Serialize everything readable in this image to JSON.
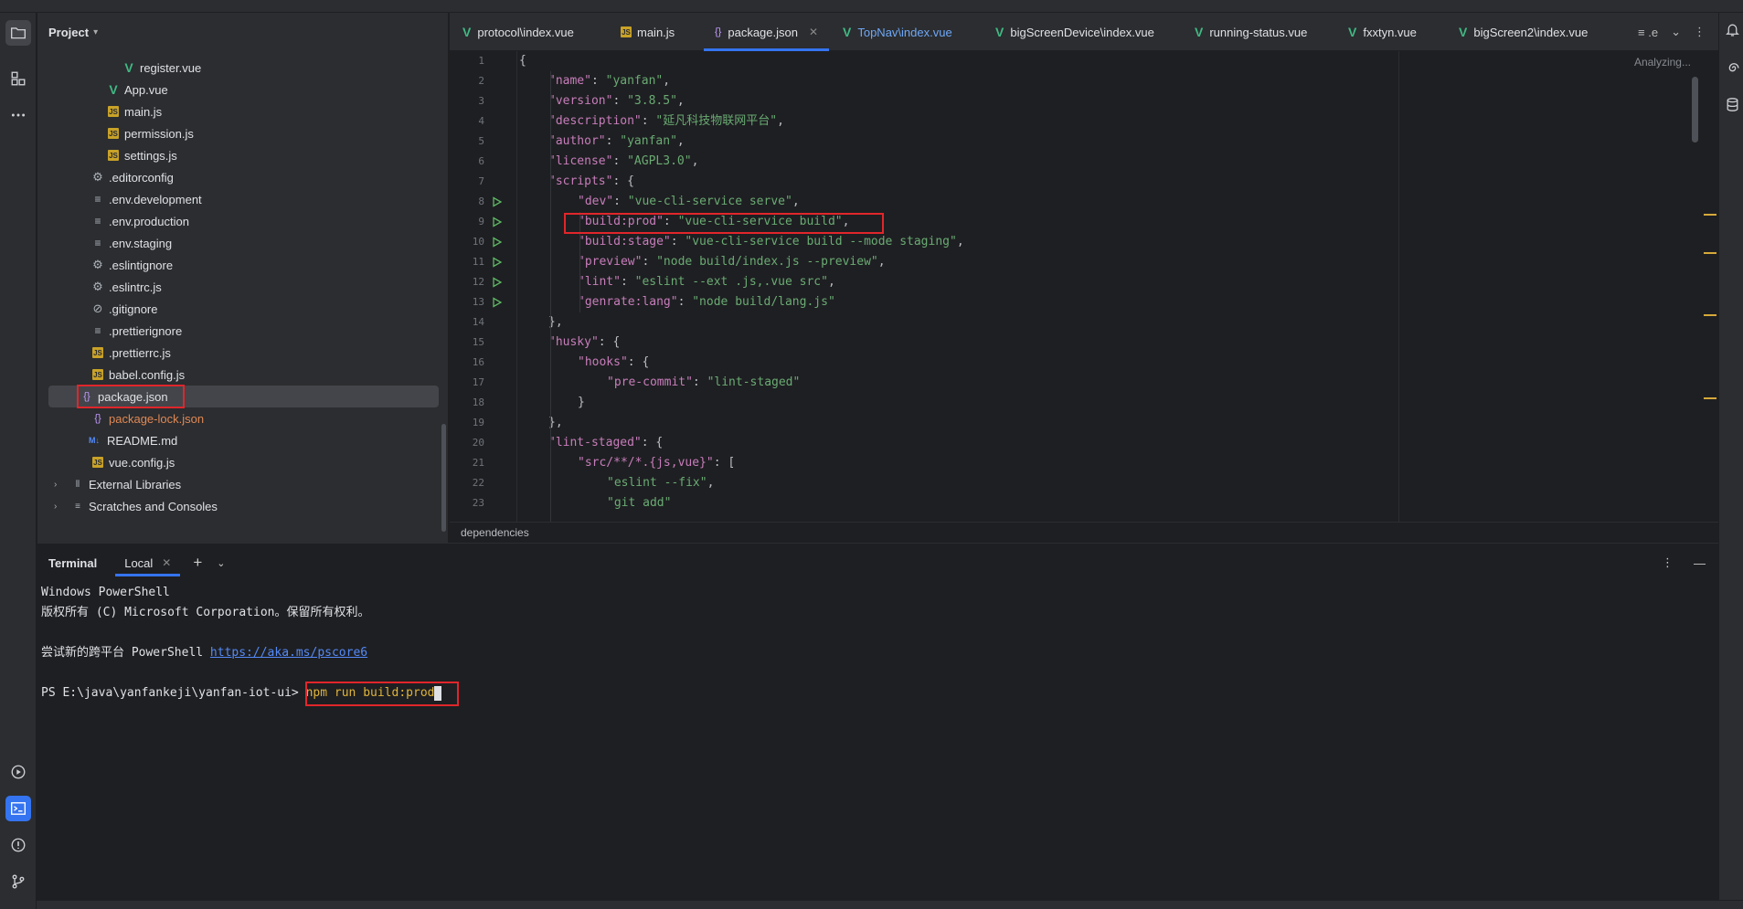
{
  "project": {
    "title": "Project",
    "items": [
      {
        "name": "register.vue",
        "icon": "vue-icon"
      },
      {
        "name": "App.vue",
        "icon": "vue-icon"
      },
      {
        "name": "main.js",
        "icon": "js-icon"
      },
      {
        "name": "permission.js",
        "icon": "js-icon"
      },
      {
        "name": "settings.js",
        "icon": "js-icon"
      },
      {
        "name": ".editorconfig",
        "icon": "gear-icon"
      },
      {
        "name": ".env.development",
        "icon": "lines-icon"
      },
      {
        "name": ".env.production",
        "icon": "lines-icon"
      },
      {
        "name": ".env.staging",
        "icon": "lines-icon"
      },
      {
        "name": ".eslintignore",
        "icon": "gear-icon"
      },
      {
        "name": ".eslintrc.js",
        "icon": "gear-icon"
      },
      {
        "name": ".gitignore",
        "icon": "ignore-icon"
      },
      {
        "name": ".prettierignore",
        "icon": "lines-icon"
      },
      {
        "name": ".prettierrc.js",
        "icon": "js-icon"
      },
      {
        "name": "babel.config.js",
        "icon": "js-icon"
      },
      {
        "name": "package.json",
        "icon": "json-icon"
      },
      {
        "name": "package-lock.json",
        "icon": "json-icon"
      },
      {
        "name": "README.md",
        "icon": "md-icon"
      },
      {
        "name": "vue.config.js",
        "icon": "js-icon"
      },
      {
        "name": "External Libraries",
        "icon": "library-icon"
      },
      {
        "name": "Scratches and Consoles",
        "icon": "scratches-icon"
      }
    ]
  },
  "tabs": [
    {
      "label": "protocol\\index.vue",
      "icon": "vue-icon"
    },
    {
      "label": "main.js",
      "icon": "js-icon"
    },
    {
      "label": "package.json",
      "icon": "json-icon",
      "active": true
    },
    {
      "label": "TopNav\\index.vue",
      "icon": "vue-icon"
    },
    {
      "label": "bigScreenDevice\\index.vue",
      "icon": "vue-icon"
    },
    {
      "label": "running-status.vue",
      "icon": "vue-icon"
    },
    {
      "label": "fxxtyn.vue",
      "icon": "vue-icon"
    },
    {
      "label": "bigScreen2\\index.vue",
      "icon": "vue-icon"
    }
  ],
  "tab_overflow_label": ".e",
  "editor": {
    "status": "Analyzing...",
    "lines": [
      {
        "n": "1",
        "indent": 0,
        "key": "",
        "val": "",
        "text": "{"
      },
      {
        "n": "2",
        "indent": 1,
        "key": "\"name\"",
        "val": "\"yanfan\"",
        "tail": ","
      },
      {
        "n": "3",
        "indent": 1,
        "key": "\"version\"",
        "val": "\"3.8.5\"",
        "tail": ","
      },
      {
        "n": "4",
        "indent": 1,
        "key": "\"description\"",
        "val": "\"延凡科技物联网平台\"",
        "tail": ","
      },
      {
        "n": "5",
        "indent": 1,
        "key": "\"author\"",
        "val": "\"yanfan\"",
        "tail": ","
      },
      {
        "n": "6",
        "indent": 1,
        "key": "\"license\"",
        "val": "\"AGPL3.0\"",
        "tail": ","
      },
      {
        "n": "7",
        "indent": 1,
        "key": "\"scripts\"",
        "val": "",
        "tail": "{"
      },
      {
        "n": "8",
        "indent": 2,
        "key": "\"dev\"",
        "val": "\"vue-cli-service serve\"",
        "tail": ",",
        "run": true
      },
      {
        "n": "9",
        "indent": 2,
        "key": "\"build:prod\"",
        "val": "\"vue-cli-service build\"",
        "tail": ",",
        "run": true
      },
      {
        "n": "10",
        "indent": 2,
        "key": "\"build:stage\"",
        "val": "\"vue-cli-service build --mode staging\"",
        "tail": ",",
        "run": true
      },
      {
        "n": "11",
        "indent": 2,
        "key": "\"preview\"",
        "val": "\"node build/index.js --preview\"",
        "tail": ",",
        "run": true
      },
      {
        "n": "12",
        "indent": 2,
        "key": "\"lint\"",
        "val": "\"eslint --ext .js,.vue src\"",
        "tail": ",",
        "run": true
      },
      {
        "n": "13",
        "indent": 2,
        "key": "\"genrate:lang\"",
        "val": "\"node build/lang.js\"",
        "tail": "",
        "run": true
      },
      {
        "n": "14",
        "indent": 1,
        "key": "",
        "val": "",
        "text": "},"
      },
      {
        "n": "15",
        "indent": 1,
        "key": "\"husky\"",
        "val": "",
        "tail": "{"
      },
      {
        "n": "16",
        "indent": 2,
        "key": "\"hooks\"",
        "val": "",
        "tail": "{"
      },
      {
        "n": "17",
        "indent": 3,
        "key": "\"pre-commit\"",
        "val": "\"lint-staged\"",
        "tail": ""
      },
      {
        "n": "18",
        "indent": 2,
        "key": "",
        "val": "",
        "text": "}"
      },
      {
        "n": "19",
        "indent": 1,
        "key": "",
        "val": "",
        "text": "},"
      },
      {
        "n": "20",
        "indent": 1,
        "key": "\"lint-staged\"",
        "val": "",
        "tail": "{"
      },
      {
        "n": "21",
        "indent": 2,
        "key": "\"src/**/*.{js,vue}\"",
        "val": "",
        "tail": "["
      },
      {
        "n": "22",
        "indent": 3,
        "key": "",
        "val": "\"eslint --fix\"",
        "tail": ","
      },
      {
        "n": "23",
        "indent": 3,
        "key": "",
        "val": "\"git add\"",
        "tail": ""
      }
    ],
    "breadcrumb": "dependencies"
  },
  "terminal": {
    "title": "Terminal",
    "tab": "Local",
    "lines": [
      "Windows PowerShell",
      "版权所有 (C) Microsoft Corporation。保留所有权利。",
      "",
      "尝试新的跨平台 PowerShell "
    ],
    "link": "https://aka.ms/pscore6",
    "prompt": "PS E:\\java\\yanfankeji\\yanfan-iot-ui> ",
    "command": "npm run build:prod"
  },
  "colors": {
    "accent": "#3574f0",
    "highlight_box": "#e0262b",
    "json_key": "#c77dbb",
    "json_string": "#6aab73"
  }
}
